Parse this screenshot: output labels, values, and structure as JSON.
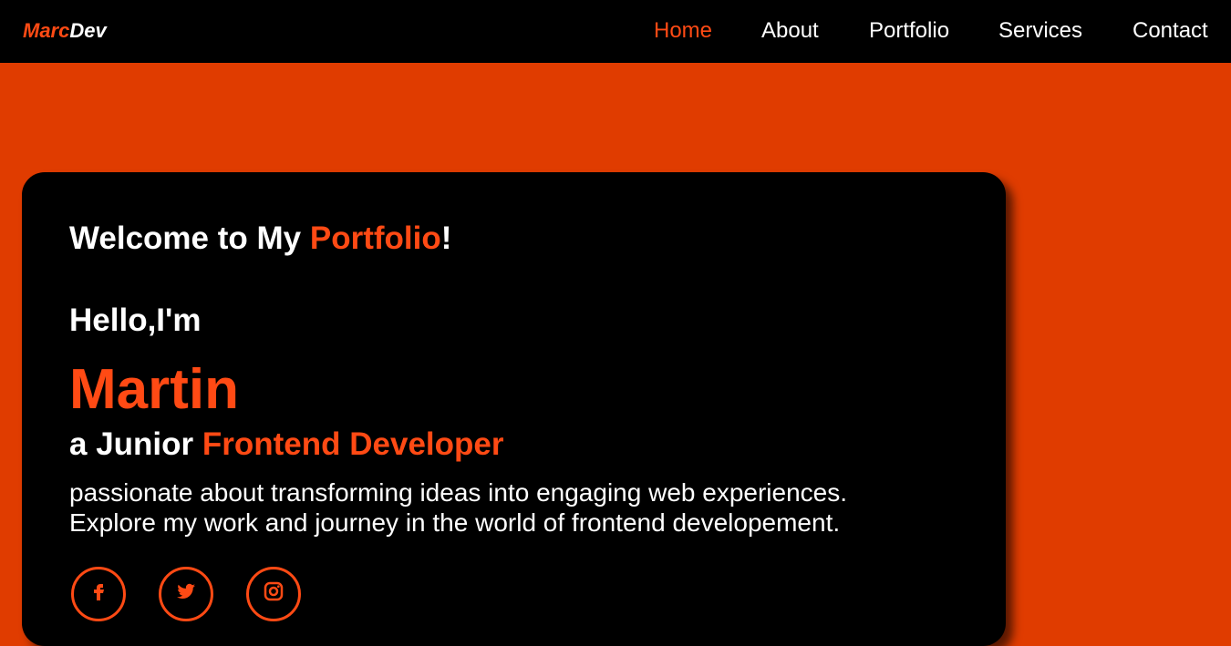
{
  "brand": {
    "part1": "Marc",
    "part2": "Dev"
  },
  "nav": {
    "items": [
      {
        "label": "Home",
        "active": true
      },
      {
        "label": "About",
        "active": false
      },
      {
        "label": "Portfolio",
        "active": false
      },
      {
        "label": "Services",
        "active": false
      },
      {
        "label": "Contact",
        "active": false
      }
    ]
  },
  "hero": {
    "welcome_prefix": "Welcome to My ",
    "welcome_accent": "Portfolio",
    "welcome_suffix": "!",
    "hello": "Hello,I'm",
    "name": "Martin",
    "role_prefix": "a Junior ",
    "role_accent": "Frontend Developer",
    "desc_line1": "passionate about transforming ideas into engaging web experiences.",
    "desc_line2": "Explore my work and journey in the world of frontend developement."
  },
  "social": [
    {
      "icon": "facebook-icon"
    },
    {
      "icon": "twitter-icon"
    },
    {
      "icon": "instagram-icon"
    }
  ],
  "colors": {
    "accent": "#ff4a14",
    "background": "#e03c00",
    "nav_bg": "#000000",
    "card_bg": "#000000",
    "text": "#ffffff"
  }
}
